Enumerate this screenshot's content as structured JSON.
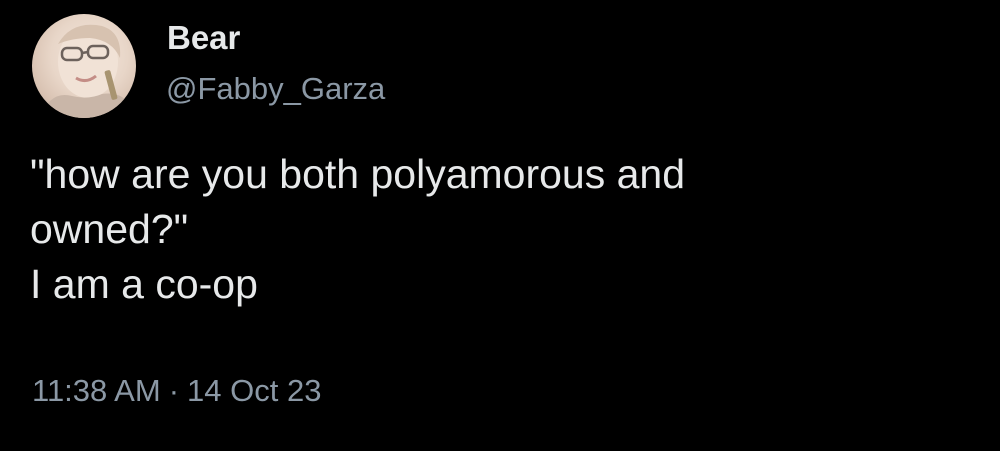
{
  "user": {
    "display_name": "Bear",
    "handle": "@Fabby_Garza",
    "avatar_icon": "profile-photo"
  },
  "tweet": {
    "lines": [
      "\"how are you both polyamorous and",
      "owned?\"",
      "I am a co-op"
    ],
    "time": "11:38 AM",
    "separator": "·",
    "date": "14 Oct 23"
  },
  "colors": {
    "background": "#000000",
    "primary_text": "#e7e9ea",
    "secondary_text": "#8b98a5"
  }
}
